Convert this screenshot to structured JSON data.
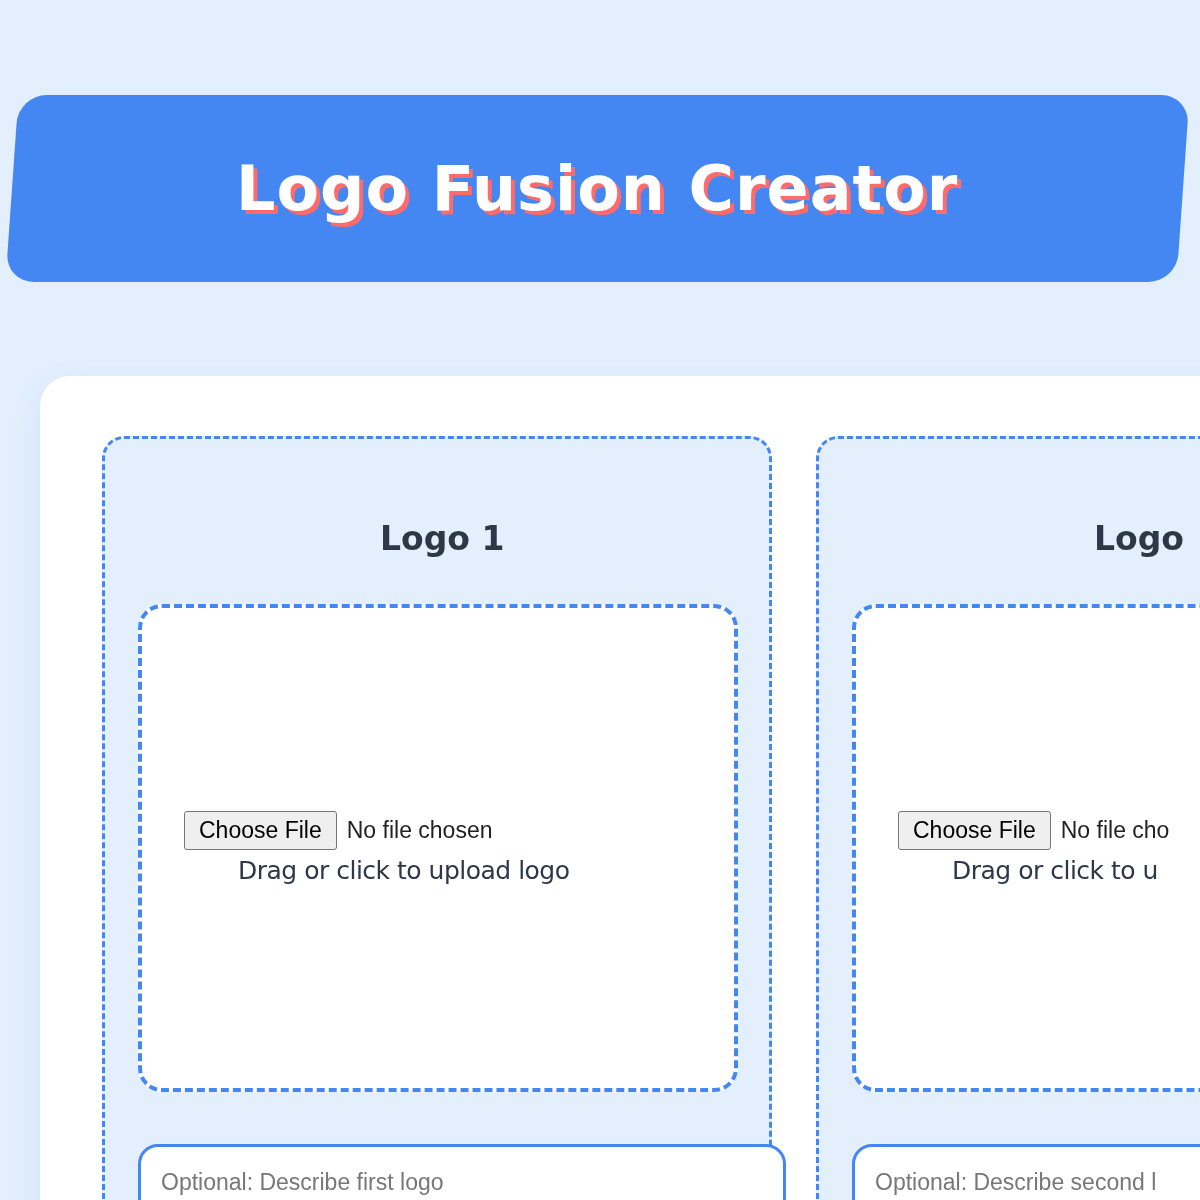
{
  "header": {
    "title": "Logo Fusion Creator"
  },
  "logos": [
    {
      "title": "Logo 1",
      "file_button": "Choose File",
      "file_status": "No file chosen",
      "upload_hint": "Drag or click to upload logo",
      "description": {
        "placeholder": "Optional: Describe first logo"
      }
    },
    {
      "title": "Logo",
      "file_button": "Choose File",
      "file_status": "No file cho",
      "upload_hint": "Drag or click to u",
      "description": {
        "placeholder": "Optional: Describe second l"
      }
    }
  ]
}
